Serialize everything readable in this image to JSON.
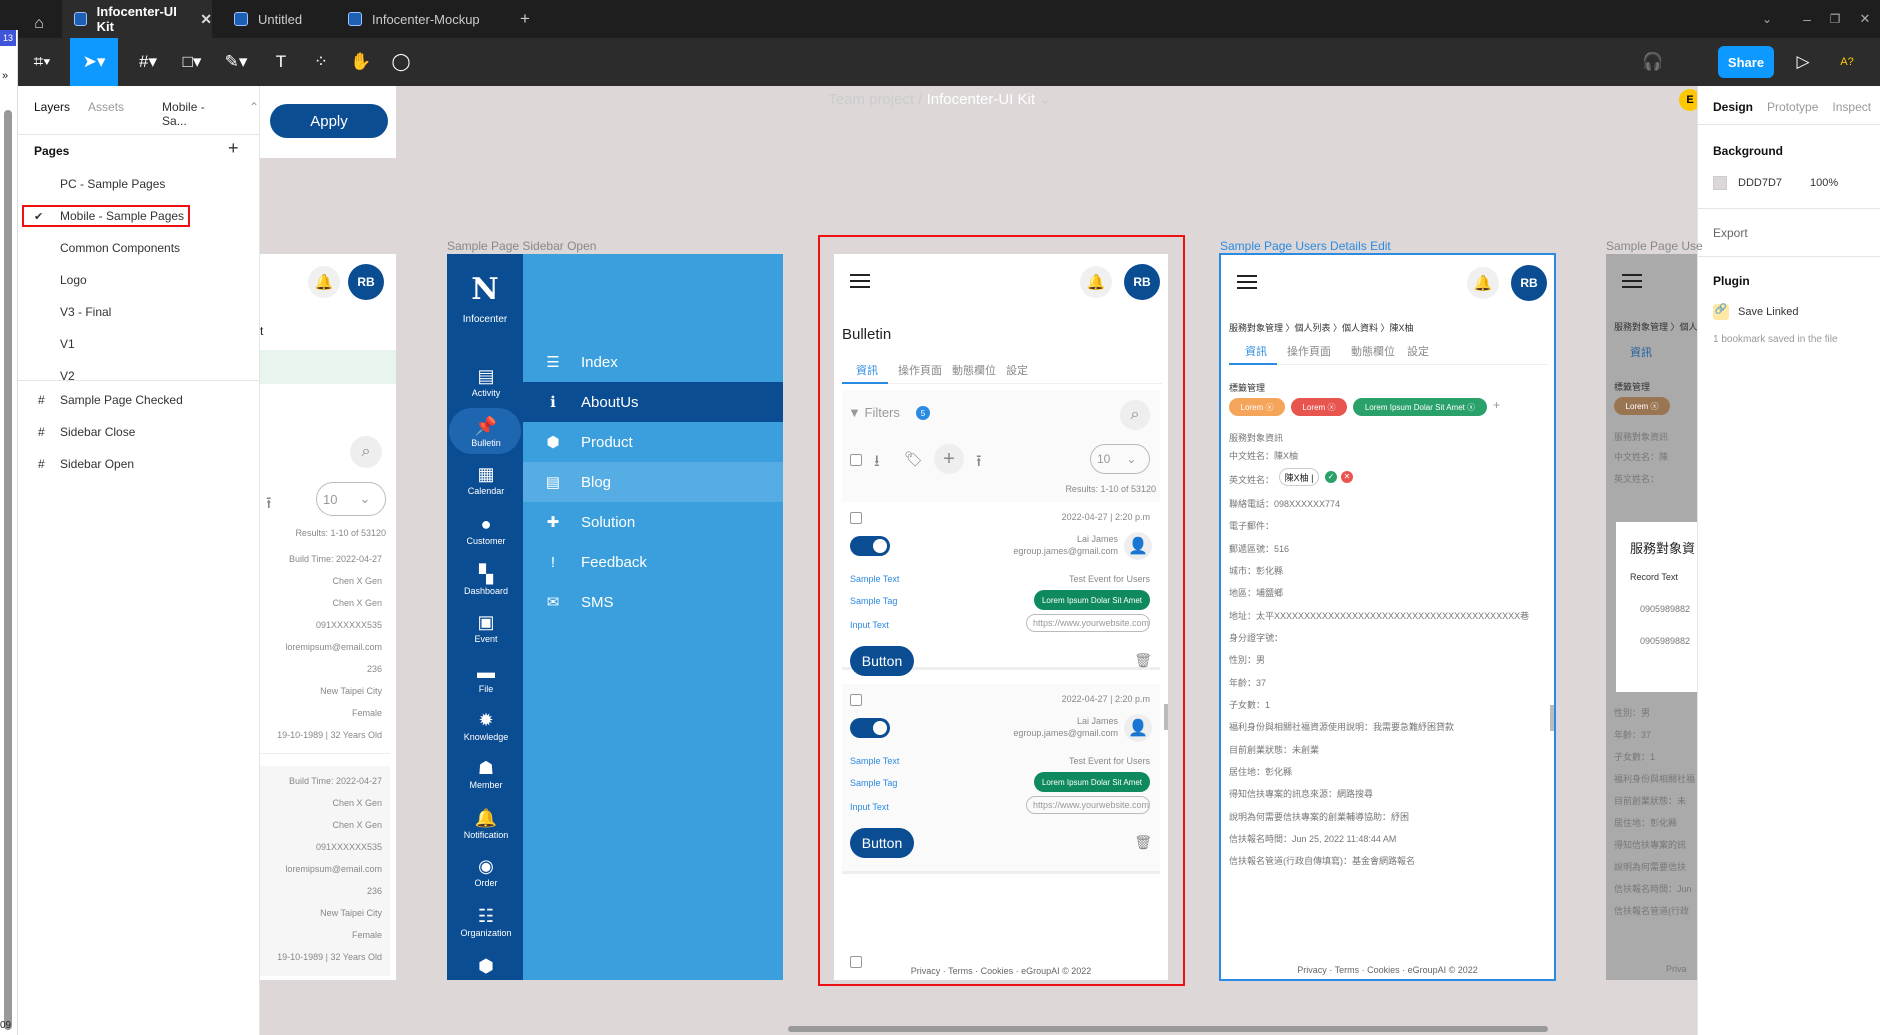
{
  "tabs": [
    {
      "label": "Infocenter-UI Kit"
    },
    {
      "label": "Untitled"
    },
    {
      "label": "Infocenter-Mockup"
    }
  ],
  "breadcrumb": {
    "team": "Team project",
    "sep": "/",
    "file": "Infocenter-UI Kit"
  },
  "share_label": "Share",
  "user_initial": "E",
  "help_label": "A?",
  "left_panel": {
    "tab_layers": "Layers",
    "tab_assets": "Assets",
    "page_select": "Mobile - Sa...",
    "pages_header": "Pages",
    "pages": [
      "PC - Sample Pages",
      "Mobile - Sample Pages",
      "Common Components",
      "Logo",
      "V3 - Final",
      "V1",
      "V2"
    ],
    "frames": [
      "Sample Page Checked",
      "Sidebar Close",
      "Sidebar Open"
    ]
  },
  "right_panel": {
    "tabs": [
      "Design",
      "Prototype",
      "Inspect"
    ],
    "background_label": "Background",
    "bg_hex": "DDD7D7",
    "bg_opacity": "100%",
    "export_label": "Export",
    "plugin_label": "Plugin",
    "plugin_item": "Save Linked",
    "plugin_note": "1 bookmark saved in the file"
  },
  "side_badge": "13",
  "side_num": "09",
  "apply_label": "Apply",
  "frame_labels": {
    "sidebar_open": "Sample Page Sidebar Open",
    "users_edit": "Sample Page Users Details Edit",
    "users_cut": "Sample Page Use"
  },
  "left_frame": {
    "initials": "RB",
    "select_value": "10",
    "results": "Results: 1-10 of 53120",
    "block": [
      "Build Time: 2022-04-27",
      "Chen X Gen",
      "Chen X Gen",
      "091XXXXXX535",
      "loremipsum@email.com",
      "236",
      "New Taipei City",
      "Female",
      "19-10-1989 | 32 Years Old"
    ],
    "letter": "t"
  },
  "sidebar_frame": {
    "brand": "Infocenter",
    "nav": [
      "Activity",
      "Bulletin",
      "Calendar",
      "Customer",
      "Dashboard",
      "Event",
      "File",
      "Knowledge",
      "Member",
      "Notification",
      "Order",
      "Organization"
    ],
    "menu": [
      "Index",
      "AboutUs",
      "Product",
      "Blog",
      "Solution",
      "Feedback",
      "SMS"
    ]
  },
  "bulletin": {
    "initials": "RB",
    "title": "Bulletin",
    "tabs": [
      "資訊",
      "操作頁面",
      "動態欄位",
      "設定"
    ],
    "filters": "Filters",
    "filter_count": "5",
    "select_value": "10",
    "results": "Results: 1-10 of 53120",
    "cards": [
      {
        "date": "2022-04-27 | 2:20 p.m",
        "name": "Lai James",
        "email": "egroup.james@gmail.com",
        "sample_text_label": "Sample Text",
        "sample_text_value": "Test Event for Users",
        "sample_tag_label": "Sample Tag",
        "tag": "Lorem Ipsum Dolar Sit Amet",
        "input_label": "Input Text",
        "input_placeholder": "https://www.yourwebsite.com",
        "button": "Button"
      },
      {
        "date": "2022-04-27 | 2:20 p.m",
        "name": "Lai James",
        "email": "egroup.james@gmail.com",
        "sample_text_label": "Sample Text",
        "sample_text_value": "Test Event for Users",
        "sample_tag_label": "Sample Tag",
        "tag": "Lorem Ipsum Dolar Sit Amet",
        "input_label": "Input Text",
        "input_placeholder": "https://www.yourwebsite.com",
        "button": "Button"
      }
    ],
    "footer": "Privacy · Terms · Cookies · eGroupAI © 2022"
  },
  "users_edit": {
    "initials": "RB",
    "breadcrumb": "服務對象管理 〉個人列表 〉個人資料 〉陳X柚",
    "tabs": [
      "資訊",
      "操作頁面",
      "動態欄位",
      "設定"
    ],
    "tag_section": "標籤管理",
    "tags": [
      {
        "label": "Lorem",
        "color": "#f4a55a"
      },
      {
        "label": "Lorem",
        "color": "#e8554e"
      },
      {
        "label": "Lorem Ipsum Dolar Sit Amet",
        "color": "#2aa06a"
      }
    ],
    "info_section": "服務對象資訊",
    "chinese_name": "中文姓名：陳X柚",
    "english_label": "英文姓名：",
    "english_value": "陳X柚 |",
    "fields": [
      "聯絡電話：098XXXXXX774",
      "電子郵件：",
      "郵遞區號：516",
      "城市：彰化縣",
      "地區：埔鹽鄉",
      "地址：太平XXXXXXXXXXXXXXXXXXXXXXXXXXXXXXXXXXXXXXXXX巷",
      "身分證字號：",
      "性別：男",
      "年齡：37",
      "子女數：1",
      "福利身份與相關社福資源使用說明：我需要急難紓困貸款",
      "目前創業狀態：未創業",
      "居住地：彰化縣",
      "得知信扶專案的訊息來源：網路搜尋",
      "說明為何需要信扶專案的創業輔導協助：紓困",
      "信扶報名時間：Jun 25, 2022 11:48:44 AM",
      "信扶報名管道(行政自傳填寫)：基金會網路報名"
    ],
    "footer": "Privacy · Terms · Cookies · eGroupAI © 2022"
  },
  "cut_frame": {
    "breadcrumb": "服務對象管理 〉個人資",
    "tab": "資訊",
    "section": "標籤管理",
    "info": "服務對象資訊",
    "name": "中文姓名：陳",
    "eng": "英文姓名：",
    "modal_title": "服務對象資",
    "modal_sub": "Record Text",
    "modal_rows": [
      "0905989882",
      "0905989882"
    ],
    "fields": [
      "性別：男",
      "年齡：37",
      "子女數：1",
      "福利身份與相關社福",
      "目前創業狀態：未",
      "居住地：彰化縣",
      "得知信扶專案的訊",
      "說明為何需要信扶",
      "信扶報名時間：Jun",
      "信扶報名管道(行政"
    ],
    "footer": "Priva"
  }
}
